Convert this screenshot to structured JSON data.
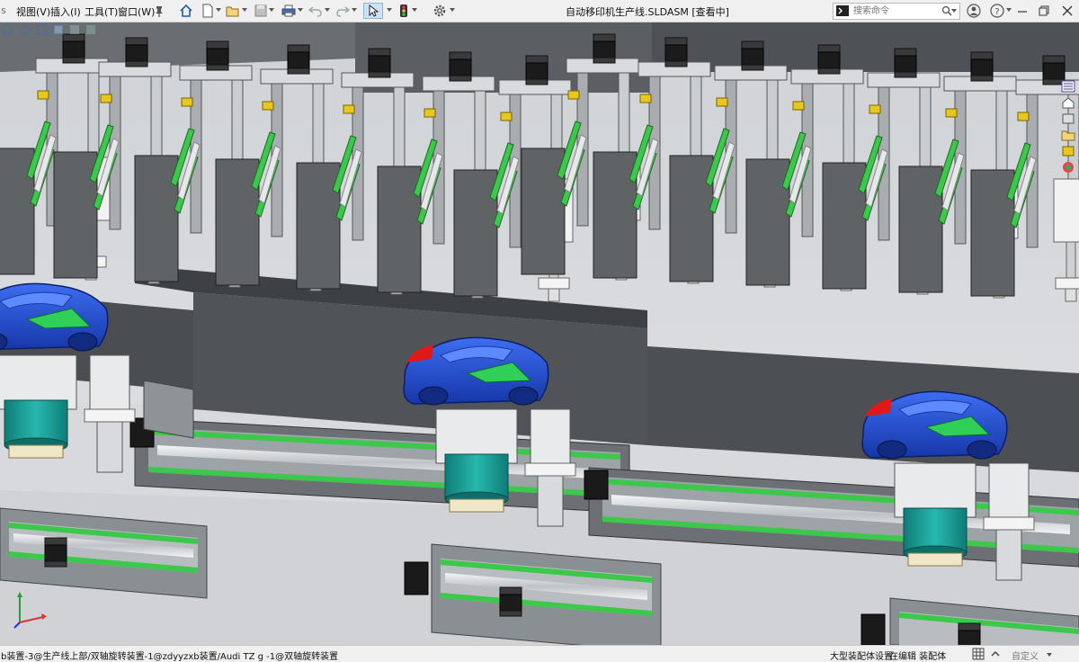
{
  "menu": {
    "view": "视图(V)",
    "insert": "插入(I)",
    "tools": "工具(T)",
    "window": "窗口(W)"
  },
  "window": {
    "title": "自动移印机生产线.SLDASM [查看中]"
  },
  "search": {
    "placeholder": "搜索命令"
  },
  "status": {
    "path": "b装置-3@生产线上部/双轴旋转装置-1@zdyyzxb装置/Audi TZ g -1@双轴旋转装置",
    "mode": "大型装配体设置",
    "editing": "在编辑 装配体",
    "custom": "自定义"
  },
  "colors": {
    "model_blue": "#1e46c8",
    "rail_green": "#3cc84a",
    "housing_gray": "#5f6366",
    "motor_teal": "#1aa39a",
    "bracket_yellow": "#e8c81e"
  },
  "icons": [
    "home-icon",
    "new-document-icon",
    "open-folder-icon",
    "save-icon",
    "print-icon",
    "undo-icon",
    "redo-icon",
    "select-pointer-icon",
    "traffic-light-icon",
    "gear-options-icon",
    "help-icon",
    "search-icon",
    "user-icon"
  ]
}
